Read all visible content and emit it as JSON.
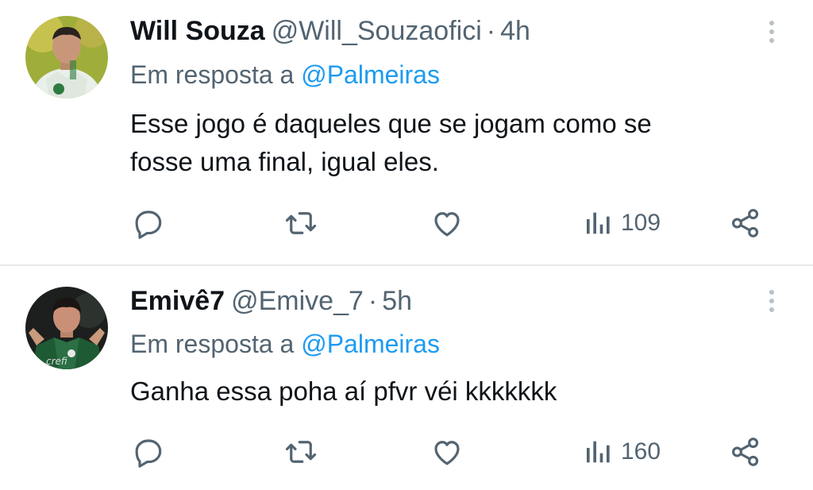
{
  "tweets": [
    {
      "display_name": "Will Souza",
      "handle": "@Will_Souzaofici",
      "separator": "·",
      "time": "4h",
      "reply_prefix": "Em resposta a",
      "reply_mention": "@Palmeiras",
      "line1": "Esse jogo é daqueles que se jogam como se",
      "line2": "fosse uma final, igual eles.",
      "views": "109",
      "avatar_icon": "user-avatar-photo"
    },
    {
      "display_name": "Emivê7",
      "handle": "@Emive_7",
      "separator": "·",
      "time": "5h",
      "reply_prefix": "Em resposta a",
      "reply_mention": "@Palmeiras",
      "line1": "Ganha essa poha aí pfvr véi kkkkkkk",
      "line2": "",
      "views": "160",
      "avatar_icon": "user-avatar-photo"
    }
  ],
  "icons": {
    "reply": "reply-icon",
    "retweet": "retweet-icon",
    "like": "heart-icon",
    "views": "views-chart-icon",
    "share": "share-icon",
    "more": "more-vertical-icon"
  },
  "colors": {
    "text": "#0f1419",
    "secondary": "#536471",
    "link": "#1d9bf0",
    "divider": "#e6e9ec"
  }
}
